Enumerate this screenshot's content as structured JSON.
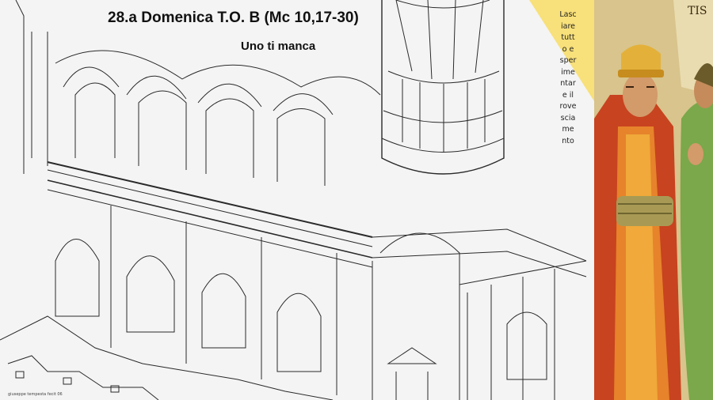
{
  "slide": {
    "title": "28.a Domenica T.O. B (Mc 10,17-30)",
    "subtitle": "Uno ti manca",
    "side_word_lines": [
      "Lasc",
      "iare",
      "tutt",
      "o e",
      "sper",
      "ime",
      "ntar",
      "e il",
      "rove",
      "scia",
      "me",
      "nto"
    ],
    "credit": "giuseppe tempesta fecit 06"
  },
  "colors": {
    "accent_yellow": "#f8e07a",
    "line_ink": "#2a2a2a",
    "robe_red": "#c8431f",
    "hat_gold": "#e3b13a",
    "sash_olive": "#a89a55",
    "robe_green": "#7aa84a",
    "wall_ochre": "#d8c48c"
  },
  "images": {
    "drawing": "architectural-cutaway-church-drawing",
    "painting": "medieval-fresco-figures"
  }
}
